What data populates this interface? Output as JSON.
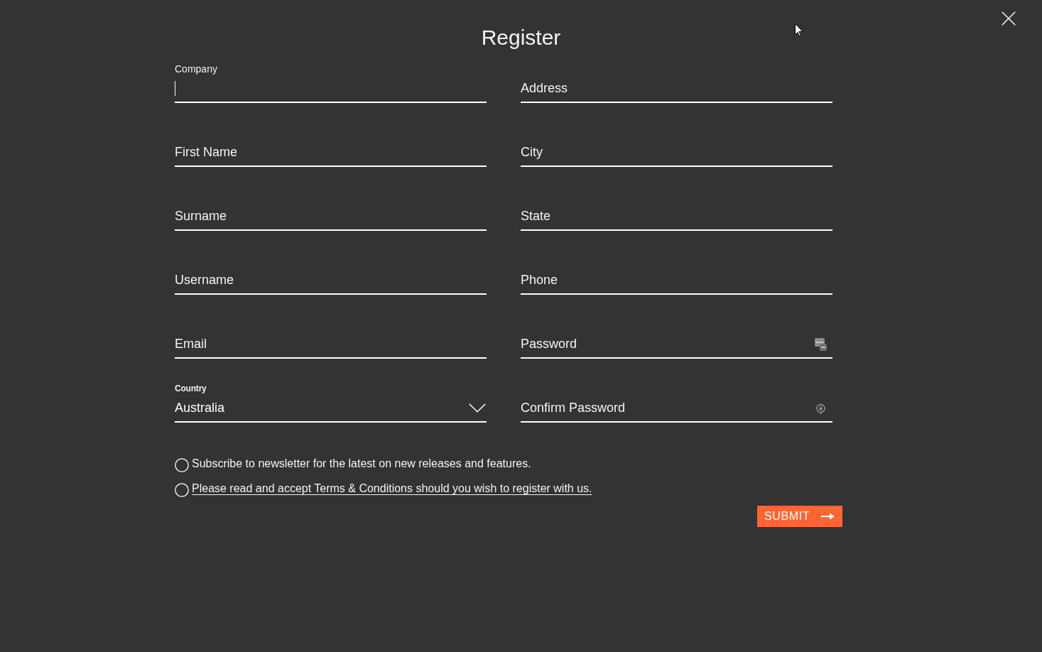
{
  "dialog": {
    "title": "Register"
  },
  "fields": [
    {
      "kind": "text",
      "label": "Company",
      "focused": true
    },
    {
      "kind": "text",
      "placeholder": "Address",
      "focused": false
    },
    {
      "kind": "text",
      "placeholder": "First Name",
      "focused": false
    },
    {
      "kind": "text",
      "placeholder": "City",
      "focused": false
    },
    {
      "kind": "text",
      "placeholder": "Surname",
      "focused": false
    },
    {
      "kind": "text",
      "placeholder": "State",
      "focused": false
    },
    {
      "kind": "text",
      "placeholder": "Username",
      "focused": false
    },
    {
      "kind": "text",
      "placeholder": "Phone",
      "focused": false
    },
    {
      "kind": "text",
      "placeholder": "Email",
      "focused": false
    },
    {
      "kind": "password",
      "placeholder": "Password",
      "focused": false
    },
    {
      "kind": "select",
      "label": "Country",
      "value": "Australia",
      "focused": false
    },
    {
      "kind": "confirm",
      "placeholder": "Confirm Password",
      "focused": false
    }
  ],
  "options": [
    {
      "kind": "text",
      "text": "Subscribe to newsletter for the latest on new releases and features.",
      "checked": false
    },
    {
      "kind": "link",
      "text": "Please read and accept Terms & Conditions should you wish to register with us.",
      "checked": false
    }
  ],
  "submit": {
    "label": "SUBMIT"
  }
}
